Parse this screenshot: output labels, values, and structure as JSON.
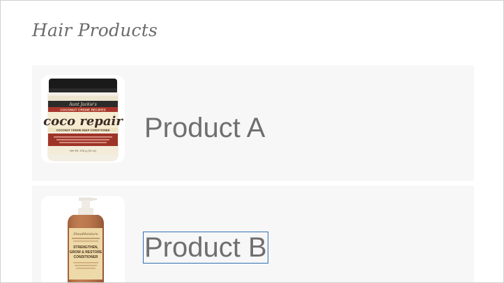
{
  "page": {
    "title": "Hair Products"
  },
  "products": [
    {
      "name": "Product A",
      "image_icon": "coconut-creme-jar-image",
      "label": {
        "brand": "Aunt Jackie's",
        "line1": "COCONUT CREME RECIPES",
        "line2": "coco repair",
        "line3": "COCONUT CREME DEEP CONDITIONER",
        "size": "Net Wt. 426 g (15 oz)"
      }
    },
    {
      "name": "Product B",
      "image_icon": "pump-bottle-image",
      "label": {
        "brand": "SheaMoisture",
        "line1": "STRENGTHEN,",
        "line2": "GROW & RESTORE",
        "line3": "CONDITIONER"
      }
    }
  ],
  "colors": {
    "title": "#6b6b6b",
    "card_bg": "#f7f7f7",
    "focus": "#2f6fb3"
  }
}
